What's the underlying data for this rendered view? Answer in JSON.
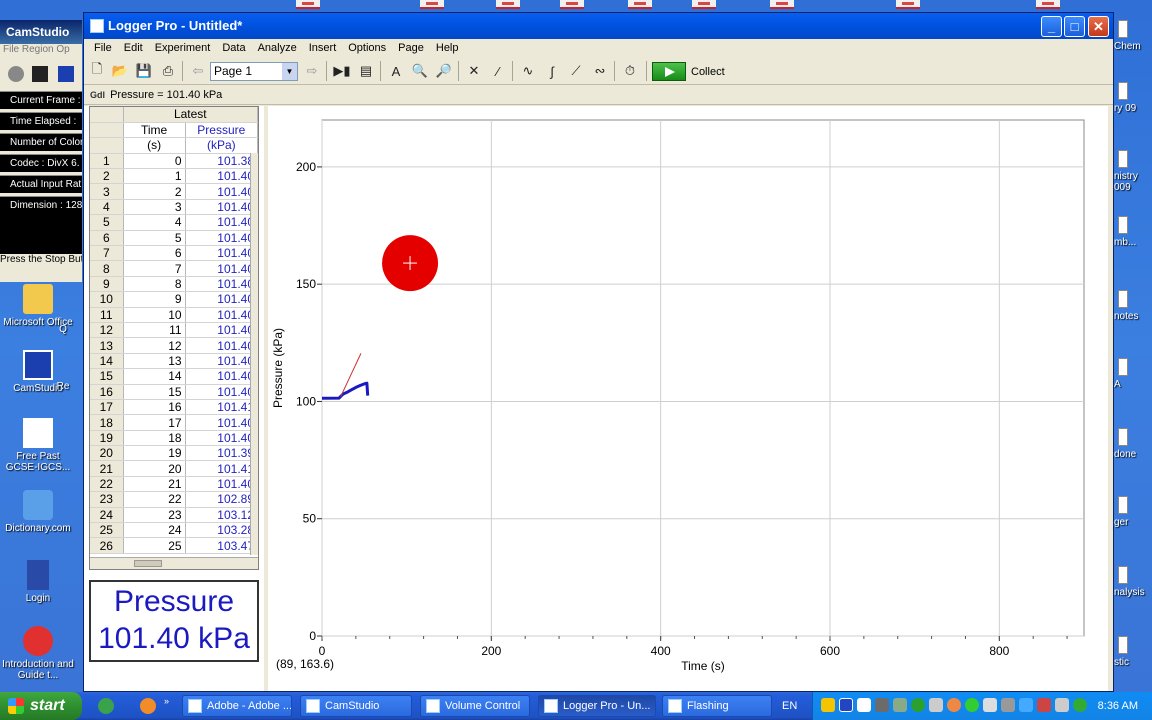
{
  "camstudio": {
    "title": "CamStudio",
    "menu": "File   Region   Op",
    "info_lines": [
      "Current Frame : 3",
      "Time Elapsed  : ",
      "Number of Colors",
      "Codec : DivX 6.",
      "Actual Input Rat",
      "Dimension : 128"
    ],
    "status": "Press the Stop But"
  },
  "desktop_icons": [
    {
      "label": "Microsoft Office",
      "icon": "folder-icon"
    },
    {
      "label": "CamStudio",
      "icon": "camstudio-icon"
    },
    {
      "label": "Free Past GCSE-IGCS...",
      "icon": "document-icon"
    },
    {
      "label": "Dictionary.com",
      "icon": "dictionary-icon"
    },
    {
      "label": "Login",
      "icon": "login-icon"
    },
    {
      "label": "Introduction and Guide t...",
      "icon": "guide-icon"
    }
  ],
  "desktop_icons_col2": [
    "Q",
    "Re"
  ],
  "right_icons": [
    "Chem",
    "ry 09",
    "nistry 009",
    "mb...",
    "notes",
    "A",
    "done",
    "ger",
    "nalysis",
    "stic"
  ],
  "window": {
    "title": "Logger Pro - Untitled*",
    "minimize": "_",
    "maximize": "□",
    "close": "✕"
  },
  "menu": [
    "File",
    "Edit",
    "Experiment",
    "Data",
    "Analyze",
    "Insert",
    "Options",
    "Page",
    "Help"
  ],
  "toolbar": {
    "page_select": "Page 1",
    "collect": "Collect"
  },
  "sensor_bar": {
    "badge": "Gdl",
    "reading": "Pressure = 101.40 kPa"
  },
  "table": {
    "group_header": "Latest",
    "time_header": "Time",
    "time_unit": "(s)",
    "pressure_header": "Pressure",
    "pressure_unit": "(kPa)",
    "rows": [
      [
        "1",
        "0",
        "101.38"
      ],
      [
        "2",
        "1",
        "101.40"
      ],
      [
        "3",
        "2",
        "101.40"
      ],
      [
        "4",
        "3",
        "101.40"
      ],
      [
        "5",
        "4",
        "101.40"
      ],
      [
        "6",
        "5",
        "101.40"
      ],
      [
        "7",
        "6",
        "101.40"
      ],
      [
        "8",
        "7",
        "101.40"
      ],
      [
        "9",
        "8",
        "101.40"
      ],
      [
        "10",
        "9",
        "101.40"
      ],
      [
        "11",
        "10",
        "101.40"
      ],
      [
        "12",
        "11",
        "101.40"
      ],
      [
        "13",
        "12",
        "101.40"
      ],
      [
        "14",
        "13",
        "101.40"
      ],
      [
        "15",
        "14",
        "101.40"
      ],
      [
        "16",
        "15",
        "101.40"
      ],
      [
        "17",
        "16",
        "101.41"
      ],
      [
        "18",
        "17",
        "101.40"
      ],
      [
        "19",
        "18",
        "101.40"
      ],
      [
        "20",
        "19",
        "101.39"
      ],
      [
        "21",
        "20",
        "101.41"
      ],
      [
        "22",
        "21",
        "101.40"
      ],
      [
        "23",
        "22",
        "102.89"
      ],
      [
        "24",
        "23",
        "103.12"
      ],
      [
        "25",
        "24",
        "103.28"
      ],
      [
        "26",
        "25",
        "103.47"
      ]
    ]
  },
  "meter": {
    "label": "Pressure",
    "value": "101.40 kPa"
  },
  "graph": {
    "readout": "(89, 163.6)"
  },
  "chart_data": {
    "type": "line",
    "xlabel": "Time (s)",
    "ylabel": "Pressure (kPa)",
    "xlim": [
      0,
      900
    ],
    "ylim": [
      0,
      220
    ],
    "xticks": [
      0,
      200,
      400,
      600,
      800
    ],
    "yticks": [
      0,
      50,
      100,
      150,
      200
    ],
    "grid": true,
    "series": [
      {
        "color": "#1a1ac0",
        "x": [
          0,
          20,
          25,
          30,
          35,
          40,
          45,
          50,
          53,
          54
        ],
        "y": [
          101.38,
          101.41,
          103.2,
          104.0,
          105.0,
          106.0,
          106.8,
          107.5,
          107.8,
          102.5
        ]
      }
    ],
    "tangent_line": {
      "color": "#cc3333",
      "x": [
        22,
        46
      ],
      "y": [
        102.0,
        120.5
      ]
    },
    "marker": {
      "x": 104,
      "y": 159,
      "color": "#e50000"
    }
  },
  "taskbar": {
    "start": "start",
    "tasks": [
      "Adobe - Adobe ...",
      "CamStudio",
      "Volume Control",
      "Logger Pro - Un...",
      "Flashing"
    ],
    "language": "EN",
    "clock": "8:36 AM"
  }
}
